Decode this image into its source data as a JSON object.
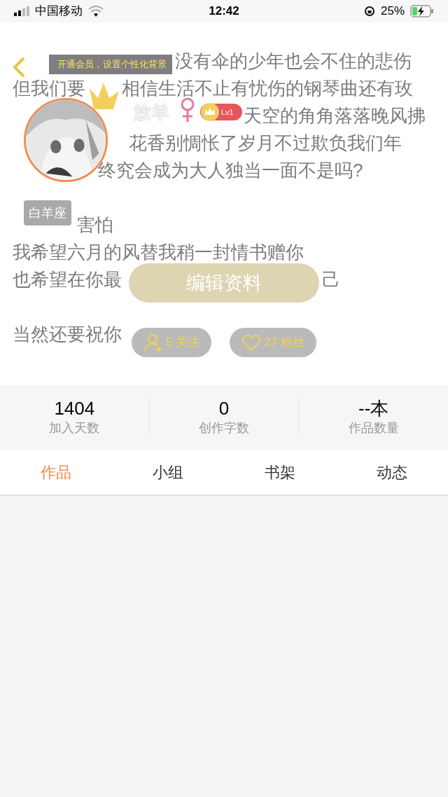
{
  "status_bar": {
    "carrier": "中国移动",
    "time": "12:42",
    "battery": "25%"
  },
  "signature": {
    "paragraphs": [
      [
        [
          "没有伞的少年也会不住的悲伤"
        ],
        [
          "但我们要",
          "相信生活不止有忧伤的钢琴曲还有玫"
        ],
        [
          "天空的角角落落晚风拂"
        ],
        [
          "花香别惆怅了岁月不过欺负我们年"
        ],
        [
          "终究会成为大人独当一面不是吗?"
        ]
      ],
      [
        [
          "害怕"
        ],
        [
          "我希望六月的风替我稍一封情书赠你"
        ],
        [
          "也希望在你最",
          "己"
        ]
      ],
      [
        [
          "当然还要祝你"
        ]
      ]
    ]
  },
  "profile": {
    "vip_banner": "开通会员，设置个性化背景",
    "username": "放羊",
    "level": "Lv1",
    "zodiac": "白羊座",
    "edit_button": "编辑资料",
    "following": "5 关注",
    "followers": "27 粉丝"
  },
  "stats": [
    {
      "value": "1404",
      "label": "加入天数"
    },
    {
      "value": "0",
      "label": "创作字数"
    },
    {
      "value": "--本",
      "label": "作品数量"
    }
  ],
  "tabs": [
    {
      "label": "作品",
      "selected": true
    },
    {
      "label": "小组",
      "selected": false
    },
    {
      "label": "书架",
      "selected": false
    },
    {
      "label": "动态",
      "selected": false
    }
  ]
}
